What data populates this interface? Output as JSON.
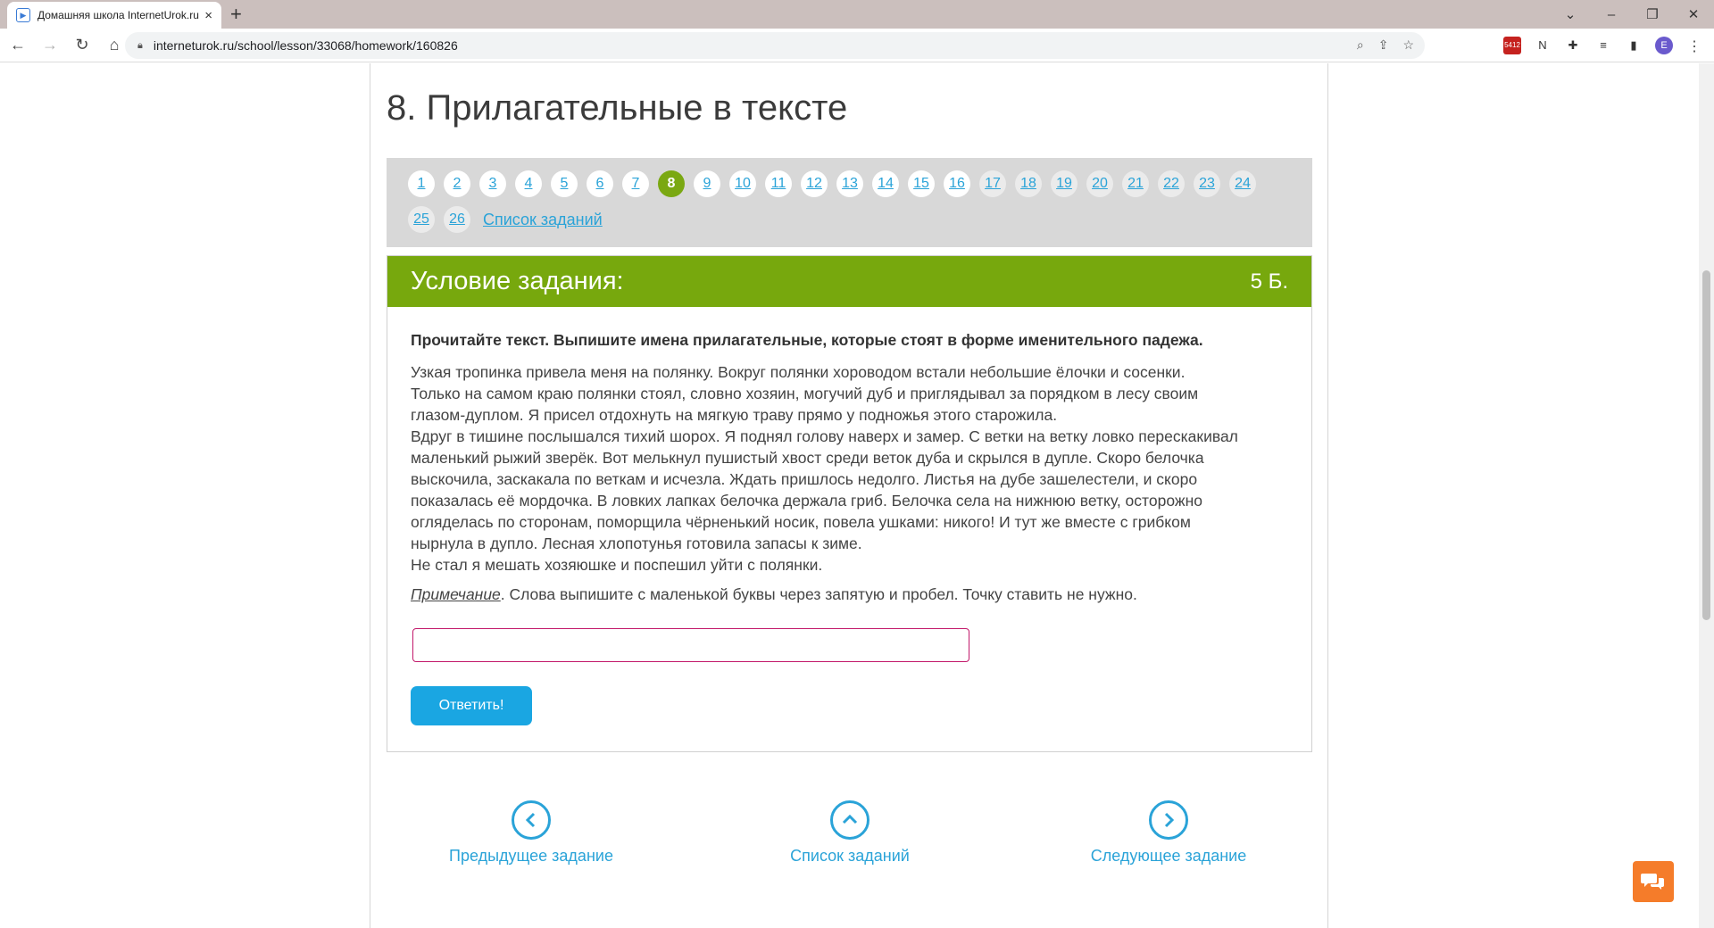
{
  "browser": {
    "tab_title": "Домашняя школа InternetUrok.ru",
    "url": "interneturok.ru/school/lesson/33068/homework/160826",
    "mail_badge": "5412",
    "profile_letter": "E"
  },
  "page": {
    "title": "8. Прилагательные в тексте"
  },
  "pager": {
    "row1": [
      "1",
      "2",
      "3",
      "4",
      "5",
      "6",
      "7",
      "8",
      "9",
      "10",
      "11",
      "12",
      "13",
      "14",
      "15",
      "16",
      "17",
      "18",
      "19",
      "20",
      "21",
      "22",
      "23",
      "24"
    ],
    "row2": [
      "25",
      "26"
    ],
    "active": "8",
    "task_list_label": "Список заданий"
  },
  "task": {
    "header_title": "Условие задания:",
    "score": "5 Б.",
    "instruction": "Прочитайте текст. Выпишите имена прилагательные, которые стоят в форме именительного падежа.",
    "text_lines": [
      "Узкая тропинка привела меня на полянку. Вокруг полянки хороводом встали небольшие ёлочки и сосенки.",
      "Только на самом краю полянки стоял, словно хозяин, могучий дуб и приглядывал за порядком в лесу своим",
      "глазом-дуплом. Я присел отдохнуть на мягкую траву прямо у подножья этого старожила.",
      "Вдруг в тишине послышался тихий шорох. Я поднял голову наверх и замер. С ветки на ветку ловко перескакивал",
      "маленький рыжий зверёк. Вот мелькнул пушистый хвост среди веток дуба и скрылся в дупле. Скоро белочка",
      "выскочила, заскакала по веткам и исчезла. Ждать пришлось недолго. Листья на дубе зашелестели, и скоро",
      "показалась её мордочка. В ловких лапках белочка держала гриб. Белочка села на нижнюю ветку, осторожно",
      "огляделась по сторонам, поморщила чёрненький носик, повела ушками: никого! И тут же вместе с грибком",
      "нырнула в дупло. Лесная хлопотунья готовила запасы к зиме.",
      "Не стал я мешать хозяюшке и поспешил уйти с полянки."
    ],
    "note_label": "Примечание",
    "note_text": ". Слова выпишите с маленькой буквы через запятую и пробел. Точку ставить не нужно.",
    "answer_value": "",
    "submit_label": "Ответить!"
  },
  "bottom_nav": {
    "prev_label": "Предыдущее задание",
    "list_label": "Список заданий",
    "next_label": "Следующее задание"
  },
  "colors": {
    "accent_green": "#77a80d",
    "link_blue": "#2aa3d8",
    "button_blue": "#1aa6e2",
    "chat_orange": "#f57c2a"
  }
}
